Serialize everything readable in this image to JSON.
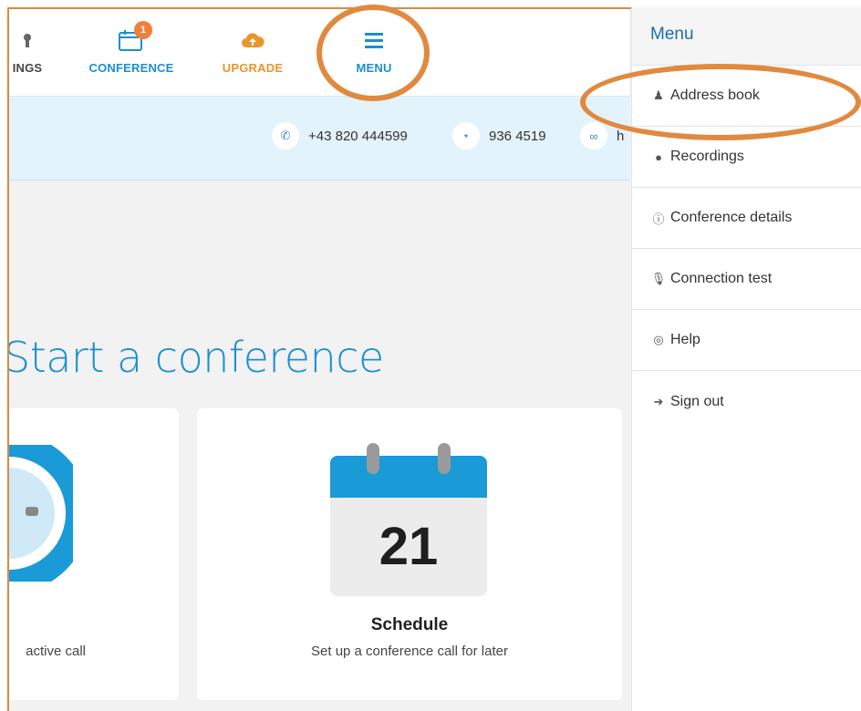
{
  "nav": {
    "settings_label": "INGS",
    "conference_label": "CONFERENCE",
    "conference_badge": "1",
    "upgrade_label": "UPGRADE",
    "menu_label": "MENU"
  },
  "info": {
    "phone": "+43 820 444599",
    "pin": "936 4519",
    "link": "h"
  },
  "main": {
    "title": "Start a conference",
    "left_card_sub": "active call",
    "calendar_day": "21",
    "schedule_title": "Schedule",
    "schedule_sub": "Set up a conference call for later"
  },
  "menu": {
    "header": "Menu",
    "items": [
      {
        "label": "Address book",
        "icon": "users-icon"
      },
      {
        "label": "Recordings",
        "icon": "record-dot-icon"
      },
      {
        "label": "Conference details",
        "icon": "info-icon"
      },
      {
        "label": "Connection test",
        "icon": "microphone-icon"
      },
      {
        "label": "Help",
        "icon": "lifebuoy-icon"
      },
      {
        "label": "Sign out",
        "icon": "sign-out-icon"
      }
    ]
  },
  "colors": {
    "accent_blue": "#1a8fd0",
    "upgrade_orange": "#e8962c",
    "annotation_orange": "#e0893f",
    "infobar_bg": "#e3f3fb"
  }
}
